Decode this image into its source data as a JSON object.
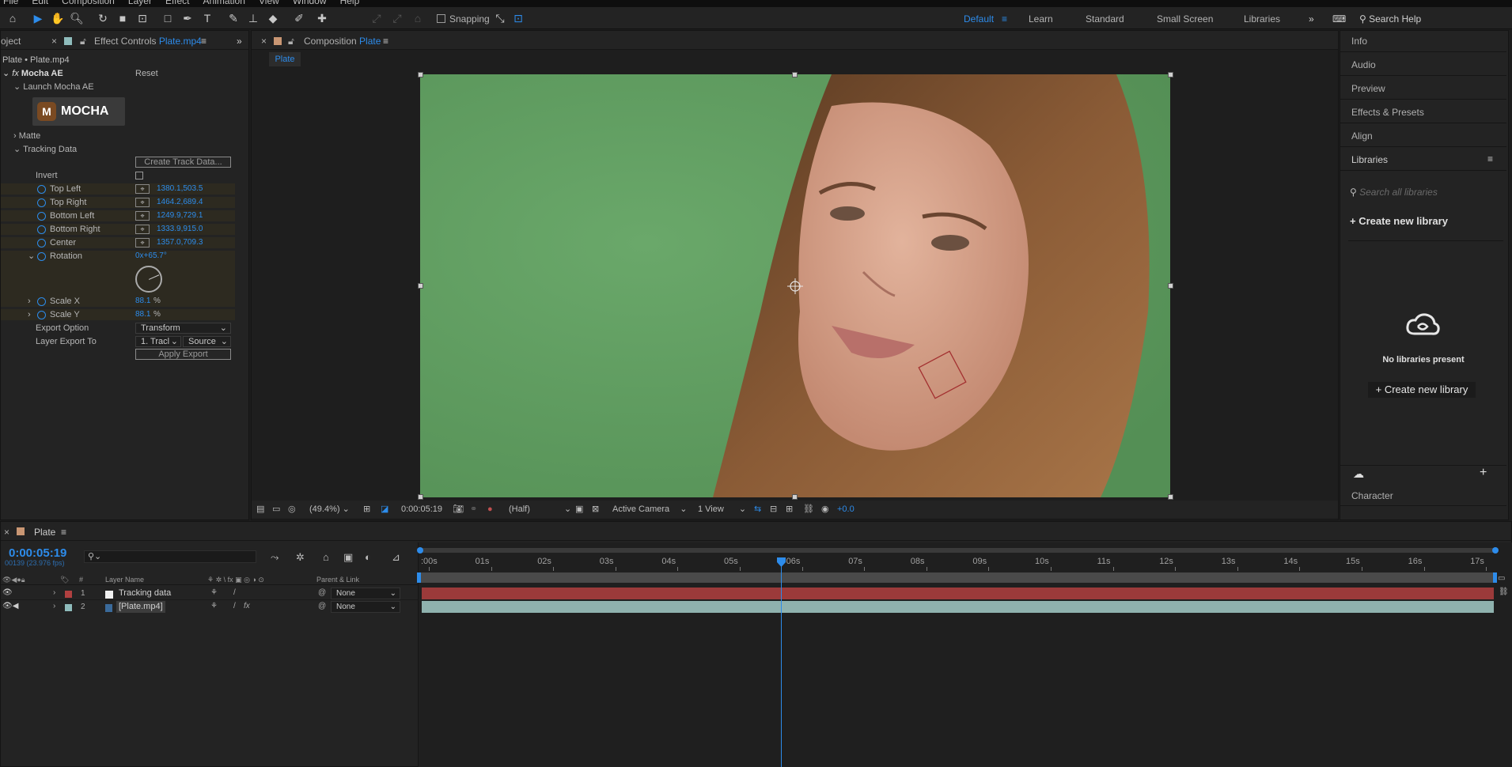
{
  "menu": [
    "File",
    "Edit",
    "Composition",
    "Layer",
    "Effect",
    "Animation",
    "View",
    "Window",
    "Help"
  ],
  "toolbar": {
    "snapping_label": "Snapping",
    "workspaces": [
      "Default",
      "Learn",
      "Standard",
      "Small Screen",
      "Libraries"
    ],
    "active_workspace": "Default",
    "search_help": "Search Help"
  },
  "left_panel": {
    "project_tab": "oject",
    "effect_tab_prefix": "Effect Controls",
    "effect_tab_file": "Plate.mp4",
    "breadcrumb": "Plate • Plate.mp4",
    "effect_name": "Mocha AE",
    "reset": "Reset",
    "launch": "Launch Mocha AE",
    "logo_text": "MOCHA",
    "matte": "Matte",
    "tracking_data": "Tracking Data",
    "create_track_btn": "Create Track Data...",
    "invert": "Invert",
    "params": [
      {
        "label": "Top Left",
        "value": "1380.1,503.5"
      },
      {
        "label": "Top Right",
        "value": "1464.2,689.4"
      },
      {
        "label": "Bottom Left",
        "value": "1249.9,729.1"
      },
      {
        "label": "Bottom Right",
        "value": "1333.9,915.0"
      },
      {
        "label": "Center",
        "value": "1357.0,709.3"
      }
    ],
    "rotation_label": "Rotation",
    "rotation_value": "0x+65.7°",
    "scale_x_label": "Scale X",
    "scale_x_value": "88.1",
    "scale_y_label": "Scale Y",
    "scale_y_value": "88.1",
    "percent": "%",
    "export_option_label": "Export Option",
    "export_option_value": "Transform",
    "layer_export_label": "Layer Export To",
    "layer_export_value": "1. Tracl",
    "layer_export_source": "Source",
    "apply_export": "Apply Export"
  },
  "composition": {
    "tab_prefix": "Composition",
    "tab_name": "Plate",
    "subtab": "Plate",
    "zoom": "(49.4%)",
    "timecode": "0:00:05:19",
    "resolution": "(Half)",
    "camera": "Active Camera",
    "views": "1 View",
    "exposure": "+0.0"
  },
  "right_panel": {
    "items": [
      "Info",
      "Audio",
      "Preview",
      "Effects & Presets",
      "Align"
    ],
    "libraries_title": "Libraries",
    "search_placeholder": "Search all libraries",
    "create_library": "Create new library",
    "no_libraries": "No libraries present",
    "create_library_btn": "+ Create new library",
    "character": "Character"
  },
  "timeline": {
    "comp_name": "Plate",
    "timecode": "0:00:05:19",
    "frames": "00139 (23.976 fps)",
    "ticks": [
      ":00s",
      "01s",
      "02s",
      "03s",
      "04s",
      "05s",
      "06s",
      "07s",
      "08s",
      "09s",
      "10s",
      "11s",
      "12s",
      "13s",
      "14s",
      "15s",
      "16s",
      "17s"
    ],
    "playhead_seconds": 5.79,
    "col_layer_name": "Layer Name",
    "col_parent": "Parent & Link",
    "col_num": "#",
    "layers": [
      {
        "num": "1",
        "name": "Tracking data",
        "parent": "None",
        "color": "#b04040"
      },
      {
        "num": "2",
        "name": "[Plate.mp4]",
        "parent": "None",
        "color": "#8fbcbc"
      }
    ]
  },
  "colors": {
    "accent": "#2d8ceb",
    "green_screen": "#5f9c5f",
    "track_red": "#9b3a3a",
    "track_teal": "#8fb2ae"
  }
}
